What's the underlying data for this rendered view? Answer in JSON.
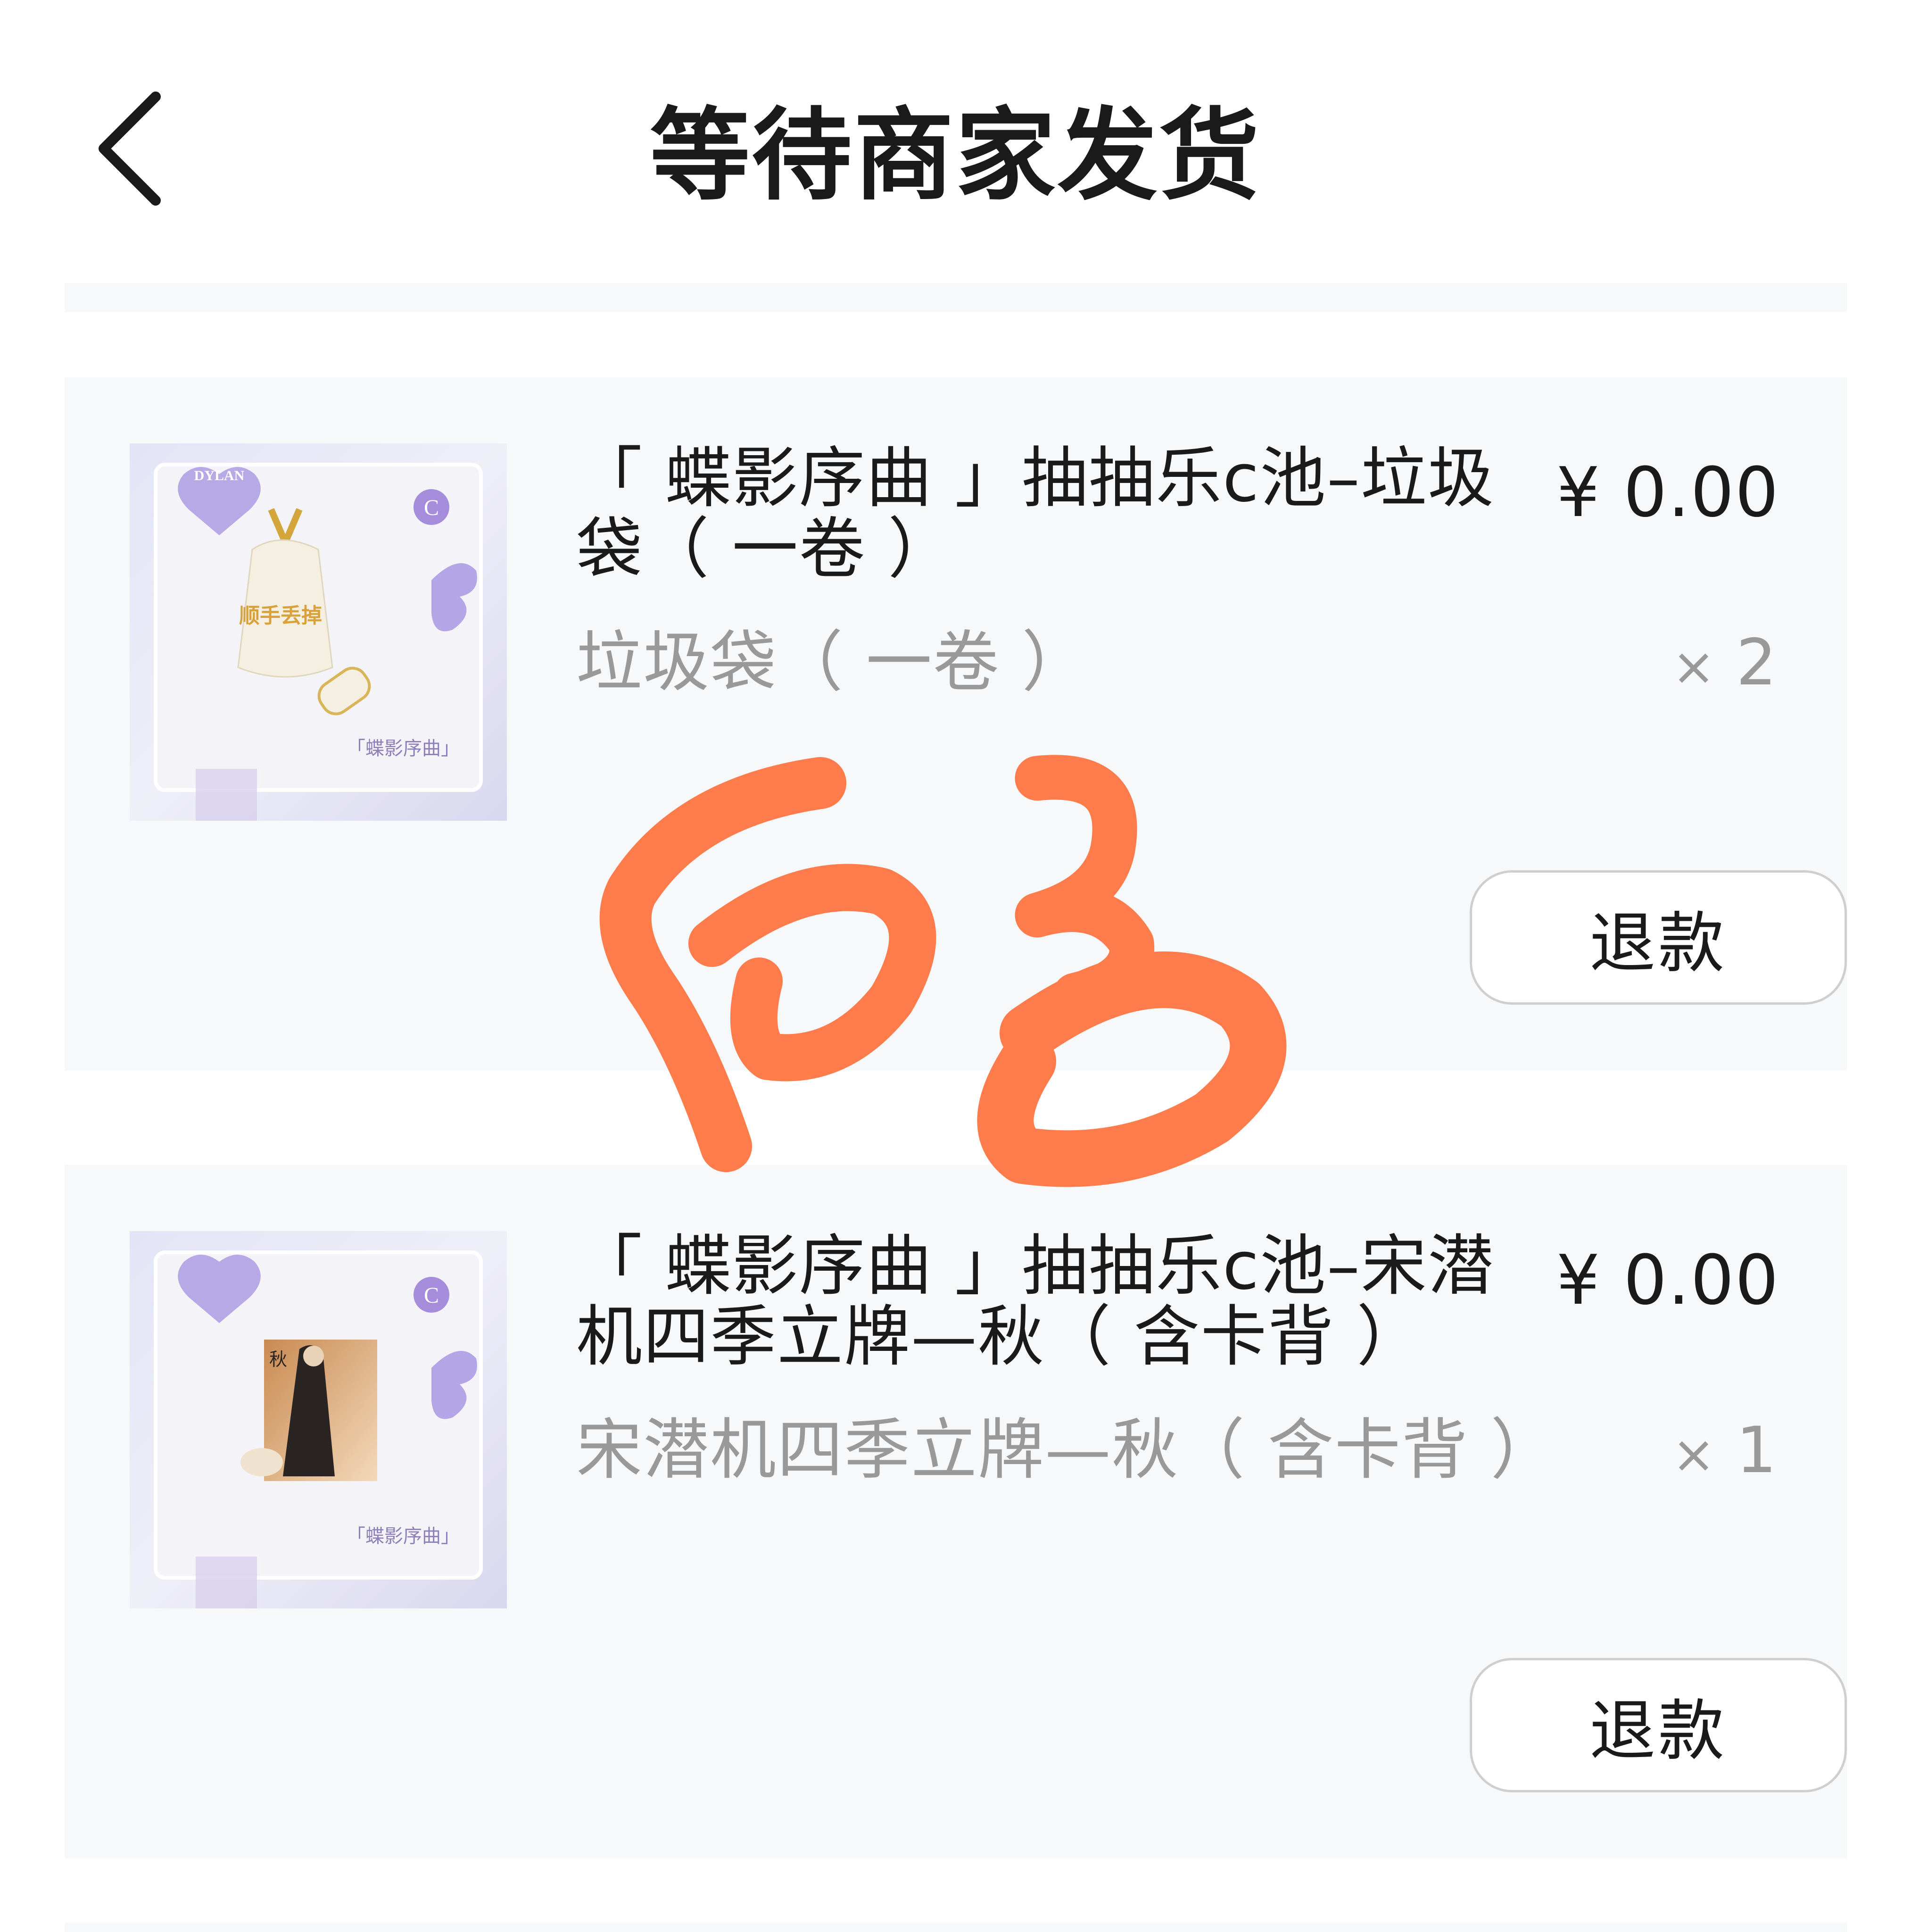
{
  "header": {
    "title": "等待商家发货",
    "back_icon": "chevron-left-icon"
  },
  "orders": [
    {
      "title": "「 蝶影序曲 」抽抽乐c池–垃圾袋（ 一卷 ）",
      "price": "¥ 0.00",
      "sku": "垃圾袋（ 一卷 ）",
      "qty_symbol": "×",
      "qty": "2",
      "refund_label": "退款",
      "thumbnail": {
        "brand_badge": "DYLAN",
        "pool_badge": "C",
        "item_text": "顺手丢掉",
        "series_label": "「蝶影序曲」"
      }
    },
    {
      "title": "「 蝶影序曲 」抽抽乐c池–宋潜机四季立牌—秋（ 含卡背 ）",
      "price": "¥ 0.00",
      "sku": "宋潜机四季立牌—秋（ 含卡背 ）",
      "qty_symbol": "×",
      "qty": "1",
      "refund_label": "退款",
      "thumbnail": {
        "pool_badge": "C",
        "item_text": "秋",
        "series_label": "「蝶影序曲」"
      }
    }
  ],
  "colors": {
    "card_background": "#f7f8fa",
    "secondary_text": "#999999",
    "signature_stroke": "#ff6a33",
    "button_border": "#cfcfcf"
  }
}
